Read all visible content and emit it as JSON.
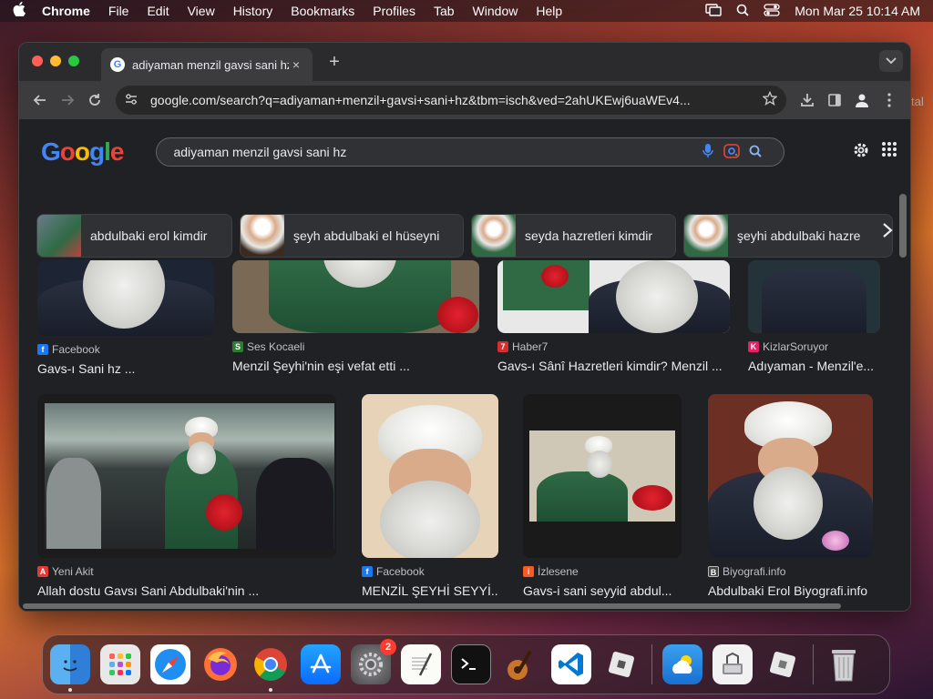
{
  "menubar": {
    "app": "Chrome",
    "items": [
      "File",
      "Edit",
      "View",
      "History",
      "Bookmarks",
      "Profiles",
      "Tab",
      "Window",
      "Help"
    ],
    "clock": "Mon Mar 25  10:14 AM"
  },
  "browser": {
    "tab_title": "adiyaman menzil gavsi sani hz",
    "tab_close": "×",
    "new_tab": "+",
    "url": "google.com/search?q=adiyaman+menzil+gavsi+sani+hz&tbm=isch&ved=2ahUKEwj6uaWEv4..."
  },
  "google": {
    "logo": [
      "G",
      "o",
      "o",
      "g",
      "l",
      "e"
    ],
    "query": "adiyaman menzil gavsi sani hz"
  },
  "chips": [
    {
      "label": "abdulbaki erol kimdir"
    },
    {
      "label": "şeyh abdulbaki el hüseyni"
    },
    {
      "label": "seyda hazretleri kimdir"
    },
    {
      "label": "şeyhi abdulbaki hazre"
    }
  ],
  "row1": [
    {
      "source": "Facebook",
      "caption": "Gavs-ı Sani hz ...",
      "src_color": "#1877f2"
    },
    {
      "source": "Ses Kocaeli",
      "caption": "Menzil Şeyhi'nin eşi vefat etti ...",
      "src_color": "#2e7d32"
    },
    {
      "source": "Haber7",
      "caption": "Gavs-ı Sânî Hazretleri kimdir? Menzil ...",
      "src_color": "#d32f2f"
    },
    {
      "source": "KizlarSoruyor",
      "caption": "Adıyaman - Menzil'e...",
      "src_color": "#e91e63"
    }
  ],
  "row2": [
    {
      "source": "Yeni Akit",
      "caption": "Allah dostu Gavsı Sani Abdulbaki'nin ...",
      "src_color": "#e53935"
    },
    {
      "source": "Facebook",
      "caption": "MENZİL ŞEYHİ SEYYİ...",
      "src_color": "#1877f2"
    },
    {
      "source": "İzlesene",
      "caption": "Gavs-i sani seyyid abdul...",
      "src_color": "#ff5722"
    },
    {
      "source": "Biyografi.info",
      "caption": "Abdulbaki Erol Biyografi.info",
      "src_color": "#444444"
    }
  ],
  "dock": {
    "settings_badge": "2"
  },
  "side_text": "tal"
}
